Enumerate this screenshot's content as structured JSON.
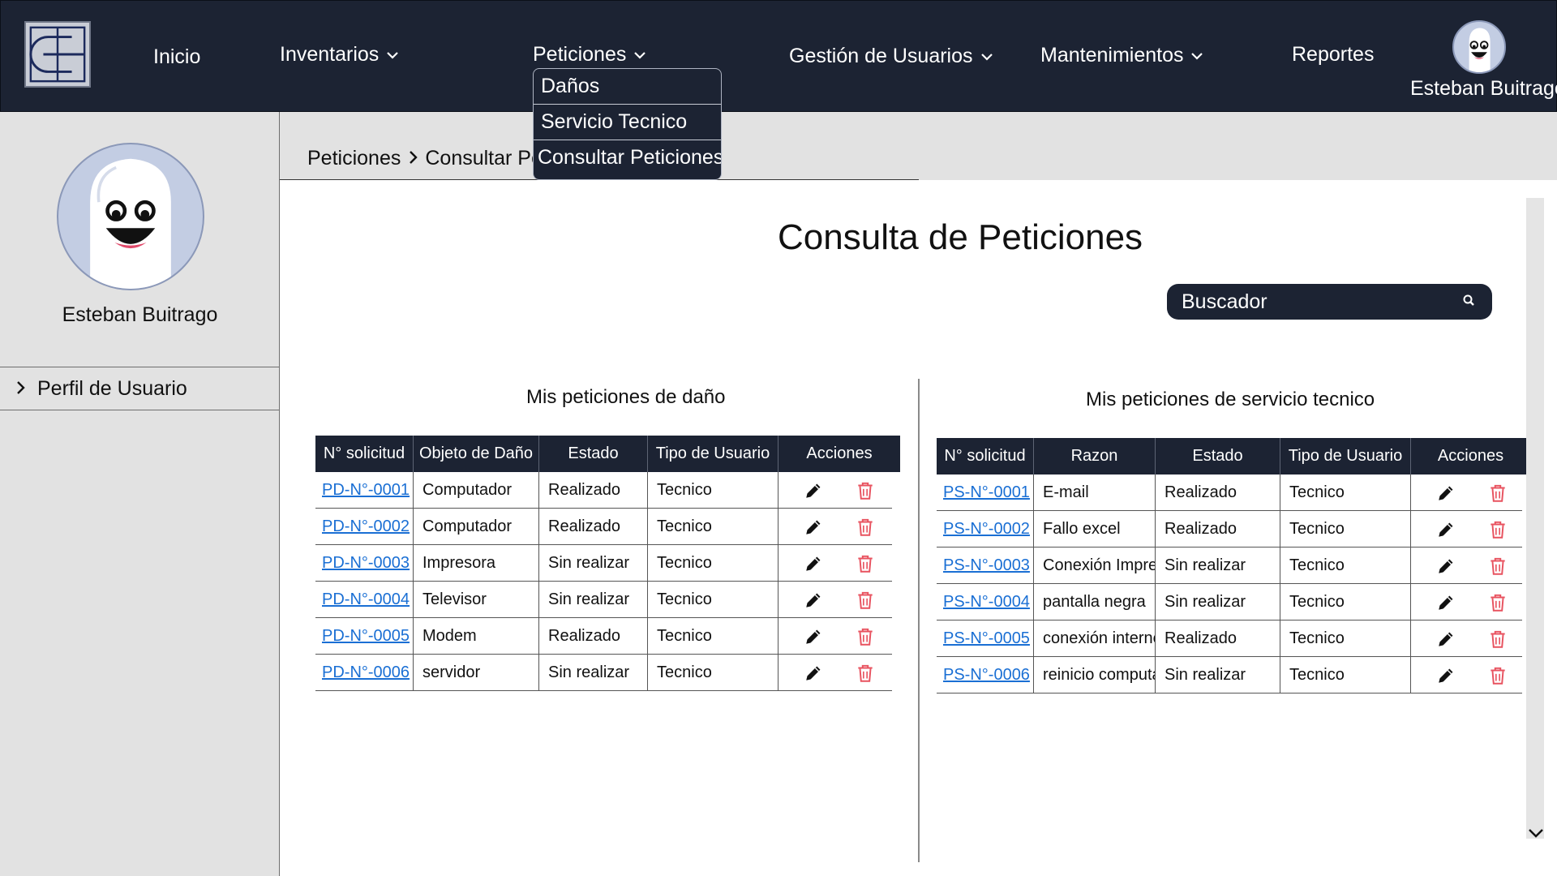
{
  "nav": {
    "items": [
      {
        "label": "Inicio",
        "has_dropdown": false
      },
      {
        "label": "Inventarios",
        "has_dropdown": true
      },
      {
        "label": "Peticiones",
        "has_dropdown": true
      },
      {
        "label": "Gestión de Usuarios",
        "has_dropdown": true
      },
      {
        "label": "Mantenimientos",
        "has_dropdown": true
      },
      {
        "label": "Reportes",
        "has_dropdown": false
      }
    ],
    "user_name": "Esteban Buitrago",
    "dropdown": [
      "Daños",
      "Servicio Tecnico",
      "Consultar Peticiones"
    ]
  },
  "sidebar": {
    "user_name": "Esteban Buitrago",
    "menu_item": "Perfil de Usuario"
  },
  "breadcrumb": {
    "parent": "Peticiones",
    "current": "Consultar Peticiones"
  },
  "page": {
    "title": "Consulta de Peticiones",
    "search_placeholder": "Buscador"
  },
  "damage_table": {
    "title": "Mis peticiones de daño",
    "headers": [
      "N° solicitud",
      "Objeto de Daño",
      "Estado",
      "Tipo de Usuario",
      "Acciones"
    ],
    "rows": [
      {
        "id": "PD-N°-0001",
        "object": "Computador",
        "status": "Realizado",
        "user_type": "Tecnico"
      },
      {
        "id": "PD-N°-0002",
        "object": "Computador",
        "status": "Realizado",
        "user_type": "Tecnico"
      },
      {
        "id": "PD-N°-0003",
        "object": "Impresora",
        "status": "Sin realizar",
        "user_type": "Tecnico"
      },
      {
        "id": "PD-N°-0004",
        "object": "Televisor",
        "status": "Sin realizar",
        "user_type": "Tecnico"
      },
      {
        "id": "PD-N°-0005",
        "object": "Modem",
        "status": "Realizado",
        "user_type": "Tecnico"
      },
      {
        "id": "PD-N°-0006",
        "object": "servidor",
        "status": "Sin realizar",
        "user_type": "Tecnico"
      }
    ]
  },
  "service_table": {
    "title": "Mis peticiones de servicio tecnico",
    "headers": [
      "N° solicitud",
      "Razon",
      "Estado",
      "Tipo de Usuario",
      "Acciones"
    ],
    "rows": [
      {
        "id": "PS-N°-0001",
        "reason": "E-mail",
        "status": "Realizado",
        "user_type": "Tecnico"
      },
      {
        "id": "PS-N°-0002",
        "reason": "Fallo excel",
        "status": "Realizado",
        "user_type": "Tecnico"
      },
      {
        "id": "PS-N°-0003",
        "reason": "Conexión Impre..",
        "status": "Sin realizar",
        "user_type": "Tecnico"
      },
      {
        "id": "PS-N°-0004",
        "reason": "pantalla negra",
        "status": "Sin realizar",
        "user_type": "Tecnico"
      },
      {
        "id": "PS-N°-0005",
        "reason": "conexión internet",
        "status": "Realizado",
        "user_type": "Tecnico"
      },
      {
        "id": "PS-N°-0006",
        "reason": "reinicio computa..",
        "status": "Sin realizar",
        "user_type": "Tecnico"
      }
    ]
  },
  "icons": {
    "edit": "pencil-icon",
    "delete": "trash-icon",
    "search": "search-icon",
    "expand": "chevron-down-icon"
  },
  "colors": {
    "navbar": "#1c2333",
    "link": "#1a6fd4",
    "delete": "#e8525f"
  }
}
